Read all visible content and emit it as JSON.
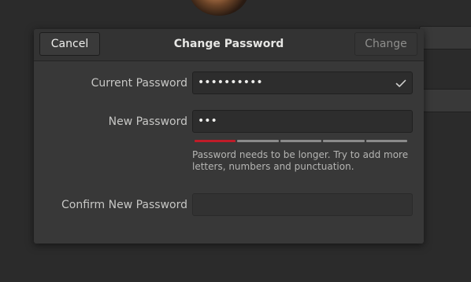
{
  "dialog": {
    "title": "Change Password",
    "cancel_label": "Cancel",
    "change_label": "Change"
  },
  "form": {
    "current_password": {
      "label": "Current Password",
      "value": "••••••••••",
      "valid": true
    },
    "new_password": {
      "label": "New Password",
      "value": "•••",
      "strength_segments": 5,
      "strength_filled": 1,
      "strength_color": "#c01c28",
      "hint": "Password needs to be longer. Try to add more letters, numbers and punctuation."
    },
    "confirm_password": {
      "label": "Confirm New Password",
      "value": ""
    }
  },
  "colors": {
    "dialog_bg": "#383838",
    "header_bg": "#333333",
    "field_bg": "#2d2d2d"
  },
  "icons": {
    "valid_check": "check-icon"
  }
}
